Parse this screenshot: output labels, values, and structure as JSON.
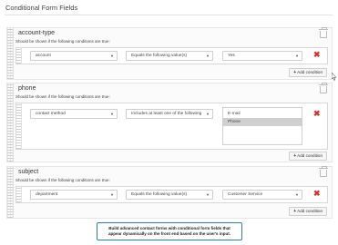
{
  "page": {
    "title": "Conditional Form Fields"
  },
  "help_text": "Should be shown if the following conditions are true:",
  "add_condition_label": "Add condition",
  "blocks": [
    {
      "field_name": "account-type",
      "conditions": [
        {
          "field": "account",
          "operator": "Equals the following value(s)",
          "value": "Yes"
        }
      ]
    },
    {
      "field_name": "phone",
      "conditions": [
        {
          "field": "contact method",
          "operator": "Includes at least one of the following",
          "options": [
            "E-mail",
            "Phone"
          ],
          "selected": "Phone"
        }
      ]
    },
    {
      "field_name": "subject",
      "conditions": [
        {
          "field": "department",
          "operator": "Equals the following value(s)",
          "value": "Customer Service"
        }
      ]
    }
  ],
  "callout": {
    "line1": "Build advanced contact forms with conditional form fields that",
    "line2": "appear dynamically on the front end based on the user's input."
  }
}
